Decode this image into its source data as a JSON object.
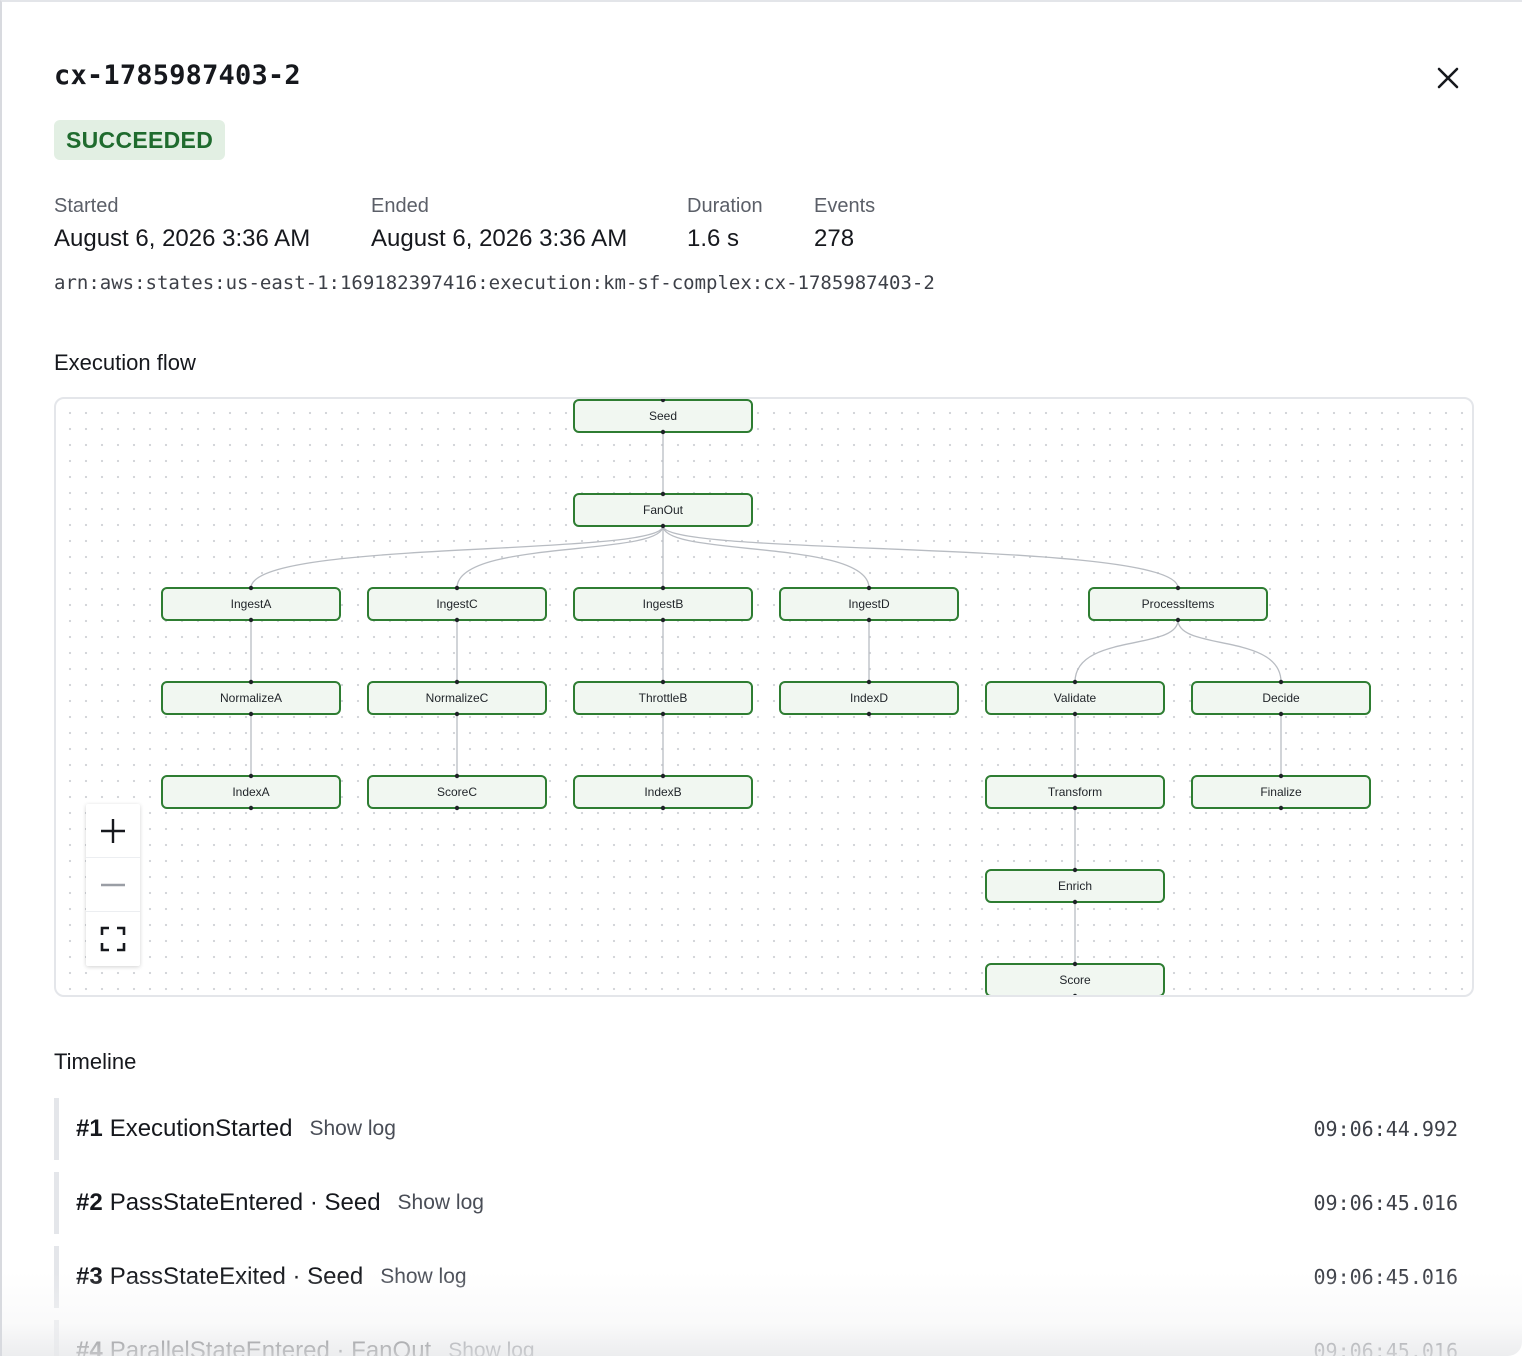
{
  "header": {
    "title": "cx-1785987403-2",
    "status": "SUCCEEDED"
  },
  "meta": {
    "started_label": "Started",
    "started_value": "August 6, 2026 3:36 AM",
    "ended_label": "Ended",
    "ended_value": "August 6, 2026 3:36 AM",
    "duration_label": "Duration",
    "duration_value": "1.6 s",
    "events_label": "Events",
    "events_value": "278"
  },
  "arn": "arn:aws:states:us-east-1:169182397416:execution:km-sf-complex:cx-1785987403-2",
  "flow": {
    "title": "Execution flow",
    "nodes": [
      {
        "id": "Seed",
        "label": "Seed"
      },
      {
        "id": "FanOut",
        "label": "FanOut"
      },
      {
        "id": "IngestA",
        "label": "IngestA"
      },
      {
        "id": "IngestC",
        "label": "IngestC"
      },
      {
        "id": "IngestB",
        "label": "IngestB"
      },
      {
        "id": "IngestD",
        "label": "IngestD"
      },
      {
        "id": "ProcessItems",
        "label": "ProcessItems"
      },
      {
        "id": "NormalizeA",
        "label": "NormalizeA"
      },
      {
        "id": "NormalizeC",
        "label": "NormalizeC"
      },
      {
        "id": "ThrottleB",
        "label": "ThrottleB"
      },
      {
        "id": "IndexD",
        "label": "IndexD"
      },
      {
        "id": "Validate",
        "label": "Validate"
      },
      {
        "id": "Decide",
        "label": "Decide"
      },
      {
        "id": "IndexA",
        "label": "IndexA"
      },
      {
        "id": "ScoreC",
        "label": "ScoreC"
      },
      {
        "id": "IndexB",
        "label": "IndexB"
      },
      {
        "id": "Transform",
        "label": "Transform"
      },
      {
        "id": "Finalize",
        "label": "Finalize"
      },
      {
        "id": "Enrich",
        "label": "Enrich"
      },
      {
        "id": "Score",
        "label": "Score"
      }
    ],
    "edges": [
      [
        "Seed",
        "FanOut"
      ],
      [
        "FanOut",
        "IngestA"
      ],
      [
        "FanOut",
        "IngestC"
      ],
      [
        "FanOut",
        "IngestB"
      ],
      [
        "FanOut",
        "IngestD"
      ],
      [
        "FanOut",
        "ProcessItems"
      ],
      [
        "IngestA",
        "NormalizeA"
      ],
      [
        "IngestC",
        "NormalizeC"
      ],
      [
        "IngestB",
        "ThrottleB"
      ],
      [
        "IngestD",
        "IndexD"
      ],
      [
        "ProcessItems",
        "Validate"
      ],
      [
        "ProcessItems",
        "Decide"
      ],
      [
        "NormalizeA",
        "IndexA"
      ],
      [
        "NormalizeC",
        "ScoreC"
      ],
      [
        "ThrottleB",
        "IndexB"
      ],
      [
        "Validate",
        "Transform"
      ],
      [
        "Decide",
        "Finalize"
      ],
      [
        "Transform",
        "Enrich"
      ],
      [
        "Enrich",
        "Score"
      ]
    ],
    "status_color": "#2e7d32"
  },
  "timeline": {
    "title": "Timeline",
    "events": [
      {
        "num": "#1",
        "name": "ExecutionStarted",
        "log": "Show log",
        "time": "09:06:44.992"
      },
      {
        "num": "#2",
        "name": "PassStateEntered · Seed",
        "log": "Show log",
        "time": "09:06:45.016"
      },
      {
        "num": "#3",
        "name": "PassStateExited · Seed",
        "log": "Show log",
        "time": "09:06:45.016"
      },
      {
        "num": "#4",
        "name": "ParallelStateEntered · FanOut",
        "log": "Show log",
        "time": "09:06:45.016"
      }
    ]
  },
  "icons": {
    "close": "close-icon",
    "zoom_in": "plus-icon",
    "zoom_out": "minus-icon",
    "fit": "fit-view-icon"
  }
}
